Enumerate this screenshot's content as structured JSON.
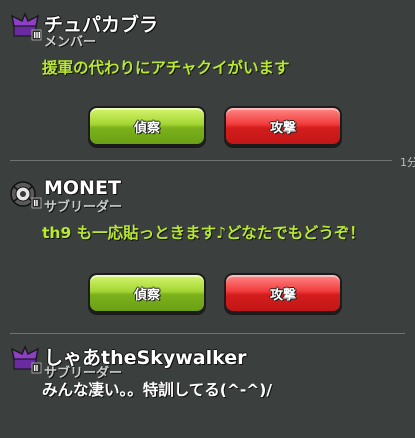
{
  "messages": [
    {
      "name": "チュパカブラ",
      "role": "メンバー",
      "text": "援軍の代わりにアチャクイがいます",
      "buttons": {
        "scout": "偵察",
        "attack": "攻撃"
      }
    },
    {
      "name": "MONET",
      "role": "サブリーダー",
      "text": "th9 も一応貼っときます♪どなたでもどうぞ！",
      "buttons": {
        "scout": "偵察",
        "attack": "攻撃"
      }
    },
    {
      "name": "しゃあtheSkywalker",
      "role": "サブリーダー",
      "text": "みんな凄い。。特訓してる(^-^)/"
    }
  ],
  "time_label": "1分",
  "colors": {
    "background": "#3b3f3e",
    "message_text_green": "#b8e830",
    "message_text_white": "#ffffff",
    "scout_button": "#8cc424",
    "attack_button": "#e02a2a"
  },
  "icons": {
    "clan_badge_purple": "purple-clan-badge-icon",
    "clan_badge_gray": "gray-clan-badge-icon"
  }
}
